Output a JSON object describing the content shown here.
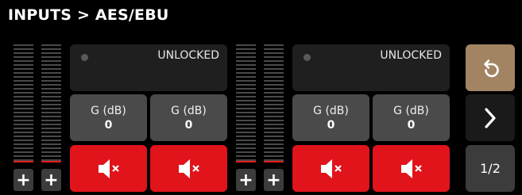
{
  "header": {
    "title": "INPUTS > AES/EBU"
  },
  "groups": [
    {
      "status": "UNLOCKED",
      "channels": [
        {
          "gain_label": "G (dB)",
          "gain_value": "0",
          "mute_icon": "speaker-mute-icon",
          "add_label": "+"
        },
        {
          "gain_label": "G (dB)",
          "gain_value": "0",
          "mute_icon": "speaker-mute-icon",
          "add_label": "+"
        }
      ]
    },
    {
      "status": "UNLOCKED",
      "channels": [
        {
          "gain_label": "G (dB)",
          "gain_value": "0",
          "mute_icon": "speaker-mute-icon",
          "add_label": "+"
        },
        {
          "gain_label": "G (dB)",
          "gain_value": "0",
          "mute_icon": "speaker-mute-icon",
          "add_label": "+"
        }
      ]
    }
  ],
  "nav": {
    "back_icon": "undo-arrow-icon",
    "next_icon": "chevron-right-icon",
    "page": "1/2"
  },
  "colors": {
    "mute_active": "#e1131b",
    "back_button": "#a28462",
    "meter_peak": "#e51a1a"
  }
}
